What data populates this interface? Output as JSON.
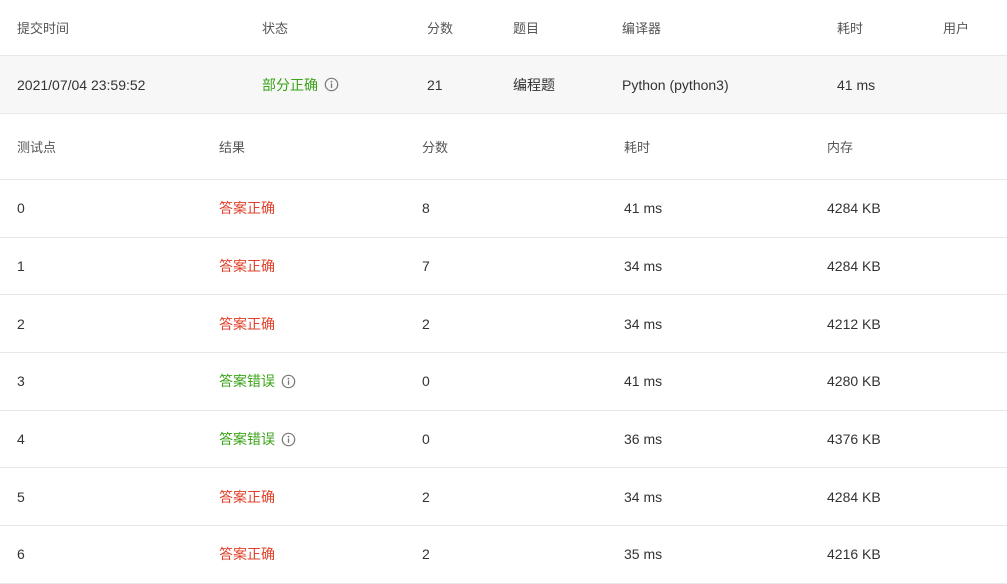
{
  "submission": {
    "headers": {
      "time": "提交时间",
      "status": "状态",
      "score": "分数",
      "problem": "题目",
      "compiler": "编译器",
      "duration": "耗时",
      "user": "用户"
    },
    "row": {
      "time": "2021/07/04 23:59:52",
      "status": "部分正确",
      "score": "21",
      "problem": "编程题",
      "compiler": "Python (python3)",
      "duration": "41 ms",
      "user": ""
    }
  },
  "testcases": {
    "headers": {
      "point": "测试点",
      "result": "结果",
      "score": "分数",
      "duration": "耗时",
      "memory": "内存"
    },
    "rows": [
      {
        "point": "0",
        "result": "答案正确",
        "score": "8",
        "duration": "41 ms",
        "memory": "4284 KB"
      },
      {
        "point": "1",
        "result": "答案正确",
        "score": "7",
        "duration": "34 ms",
        "memory": "4284 KB"
      },
      {
        "point": "2",
        "result": "答案正确",
        "score": "2",
        "duration": "34 ms",
        "memory": "4212 KB"
      },
      {
        "point": "3",
        "result": "答案错误",
        "score": "0",
        "duration": "41 ms",
        "memory": "4280 KB"
      },
      {
        "point": "4",
        "result": "答案错误",
        "score": "0",
        "duration": "36 ms",
        "memory": "4376 KB"
      },
      {
        "point": "5",
        "result": "答案正确",
        "score": "2",
        "duration": "34 ms",
        "memory": "4284 KB"
      },
      {
        "point": "6",
        "result": "答案正确",
        "score": "2",
        "duration": "35 ms",
        "memory": "4216 KB"
      }
    ]
  },
  "colors": {
    "correct": "#e0402a",
    "wrong": "#3aa318",
    "partial": "#3aa318",
    "row_highlight": "#f7f7f7"
  },
  "icons": {
    "status_info": "info-circle-icon"
  }
}
